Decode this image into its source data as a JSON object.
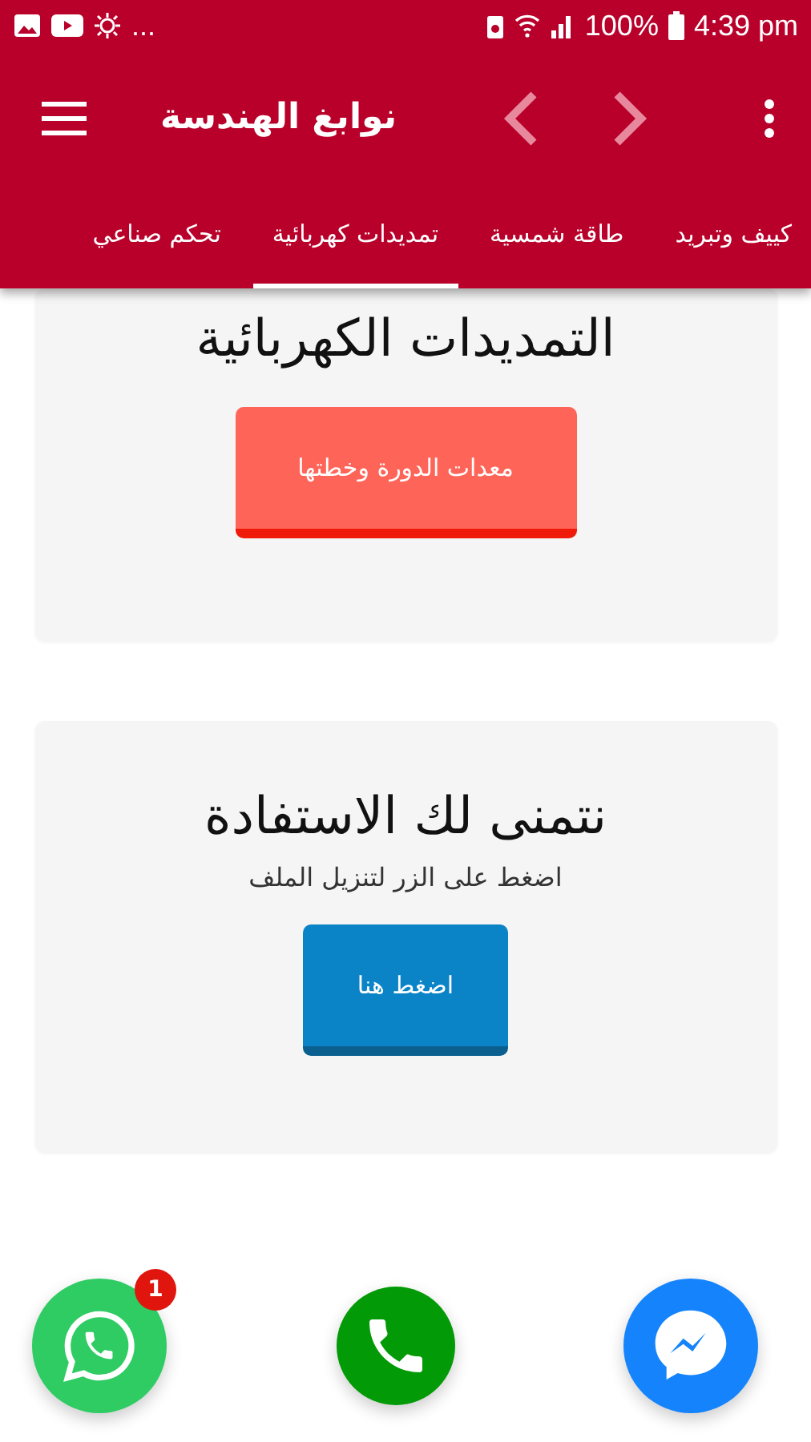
{
  "status_bar": {
    "overflow": "...",
    "battery": "100%",
    "time": "4:39 pm"
  },
  "toolbar": {
    "title": "نوابغ الهندسة"
  },
  "tabs": [
    {
      "label": "كييف وتبريد",
      "selected": false
    },
    {
      "label": "طاقة شمسية",
      "selected": false
    },
    {
      "label": "تمديدات كهربائية",
      "selected": true
    },
    {
      "label": "تحكم صناعي",
      "selected": false
    }
  ],
  "cards": [
    {
      "title": "التمديدات الكهربائية",
      "button": "معدات الدورة وخطتها",
      "kind": "coral"
    },
    {
      "title": "نتمنى لك الاستفادة",
      "subtitle": "اضغط على الزر لتنزيل الملف",
      "button": "اضغط هنا",
      "kind": "blue"
    }
  ],
  "floating": [
    {
      "kind": "whatsapp",
      "badge": "1"
    },
    {
      "kind": "phone"
    },
    {
      "kind": "messenger"
    }
  ]
}
